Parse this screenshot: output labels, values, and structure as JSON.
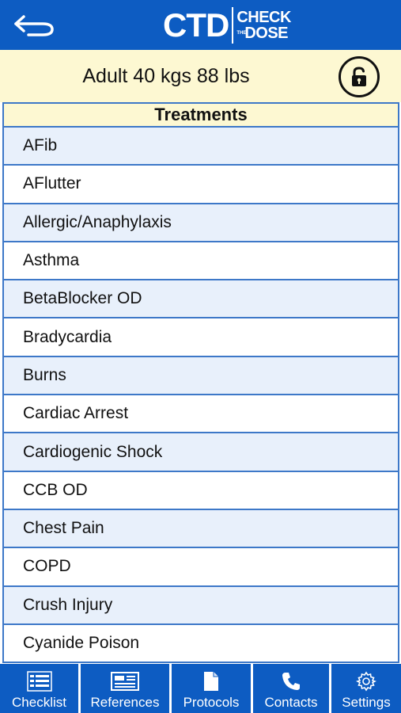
{
  "header": {
    "logo_main": "CTD",
    "logo_line1": "CHECK",
    "logo_the": "THE",
    "logo_line2": "DOSE"
  },
  "patient": {
    "summary": "Adult 40 kgs 88 lbs"
  },
  "treatments": {
    "title": "Treatments",
    "items": [
      "AFib",
      "AFlutter",
      "Allergic/Anaphylaxis",
      "Asthma",
      "BetaBlocker OD",
      "Bradycardia",
      "Burns",
      "Cardiac Arrest",
      "Cardiogenic Shock",
      "CCB OD",
      "Chest Pain",
      "COPD",
      "Crush Injury",
      "Cyanide Poison"
    ]
  },
  "tabs": [
    {
      "label": "Checklist",
      "icon": "checklist-icon"
    },
    {
      "label": "References",
      "icon": "references-icon"
    },
    {
      "label": "Protocols",
      "icon": "document-icon"
    },
    {
      "label": "Contacts",
      "icon": "phone-icon"
    },
    {
      "label": "Settings",
      "icon": "gear-icon"
    }
  ],
  "colors": {
    "primary": "#0d5cc2",
    "cream": "#fdf8d2",
    "row_alt": "#e8f0fb",
    "border": "#3d78c8"
  }
}
